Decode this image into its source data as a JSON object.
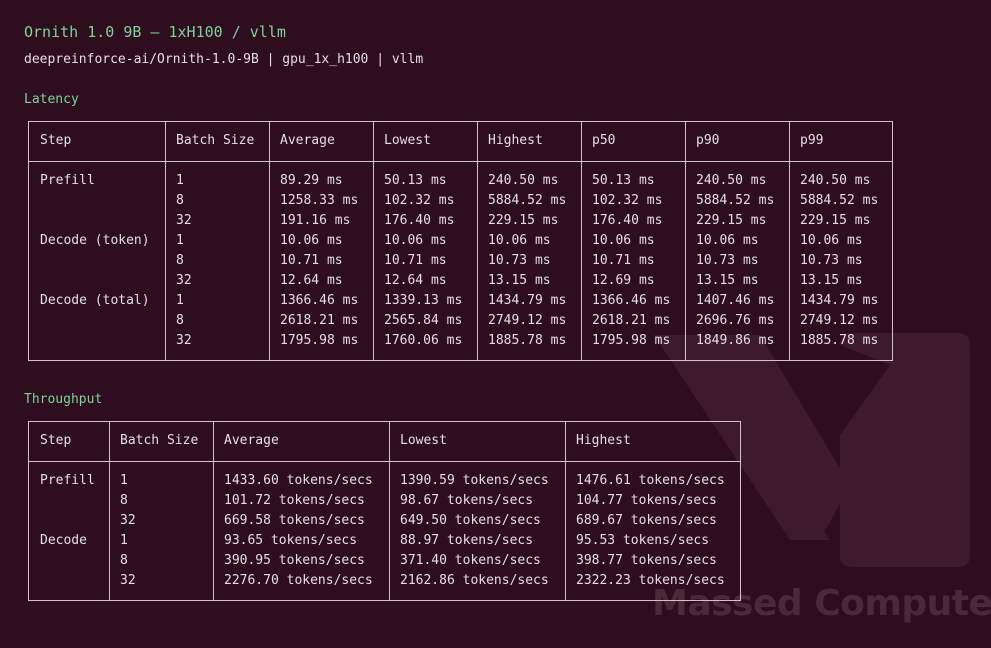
{
  "header": {
    "title": "Ornith 1.0 9B — 1xH100 / vllm",
    "subtitle": "deepreinforce-ai/Ornith-1.0-9B | gpu_1x_h100 | vllm"
  },
  "watermark": {
    "text": "Massed Compute",
    "logo_icon": "massed-compute-logo-icon"
  },
  "latency": {
    "label": "Latency",
    "columns": [
      "Step",
      "Batch Size",
      "Average",
      "Lowest",
      "Highest",
      "p50",
      "p90",
      "p99"
    ],
    "rows": [
      [
        "Prefill",
        "1",
        "89.29 ms",
        "50.13 ms",
        "240.50 ms",
        "50.13 ms",
        "240.50 ms",
        "240.50 ms"
      ],
      [
        "",
        "8",
        "1258.33 ms",
        "102.32 ms",
        "5884.52 ms",
        "102.32 ms",
        "5884.52 ms",
        "5884.52 ms"
      ],
      [
        "",
        "32",
        "191.16 ms",
        "176.40 ms",
        "229.15 ms",
        "176.40 ms",
        "229.15 ms",
        "229.15 ms"
      ],
      [
        "Decode (token)",
        "1",
        "10.06 ms",
        "10.06 ms",
        "10.06 ms",
        "10.06 ms",
        "10.06 ms",
        "10.06 ms"
      ],
      [
        "",
        "8",
        "10.71 ms",
        "10.71 ms",
        "10.73 ms",
        "10.71 ms",
        "10.73 ms",
        "10.73 ms"
      ],
      [
        "",
        "32",
        "12.64 ms",
        "12.64 ms",
        "13.15 ms",
        "12.69 ms",
        "13.15 ms",
        "13.15 ms"
      ],
      [
        "Decode (total)",
        "1",
        "1366.46 ms",
        "1339.13 ms",
        "1434.79 ms",
        "1366.46 ms",
        "1407.46 ms",
        "1434.79 ms"
      ],
      [
        "",
        "8",
        "2618.21 ms",
        "2565.84 ms",
        "2749.12 ms",
        "2618.21 ms",
        "2696.76 ms",
        "2749.12 ms"
      ],
      [
        "",
        "32",
        "1795.98 ms",
        "1760.06 ms",
        "1885.78 ms",
        "1795.98 ms",
        "1849.86 ms",
        "1885.78 ms"
      ]
    ]
  },
  "throughput": {
    "label": "Throughput",
    "columns": [
      "Step",
      "Batch Size",
      "Average",
      "Lowest",
      "Highest"
    ],
    "rows": [
      [
        "Prefill",
        "1",
        "1433.60 tokens/secs",
        "1390.59 tokens/secs",
        "1476.61 tokens/secs"
      ],
      [
        "",
        "8",
        "101.72 tokens/secs",
        "98.67 tokens/secs",
        "104.77 tokens/secs"
      ],
      [
        "",
        "32",
        "669.58 tokens/secs",
        "649.50 tokens/secs",
        "689.67 tokens/secs"
      ],
      [
        "Decode",
        "1",
        "93.65 tokens/secs",
        "88.97 tokens/secs",
        "95.53 tokens/secs"
      ],
      [
        "",
        "8",
        "390.95 tokens/secs",
        "371.40 tokens/secs",
        "398.77 tokens/secs"
      ],
      [
        "",
        "32",
        "2276.70 tokens/secs",
        "2162.86 tokens/secs",
        "2322.23 tokens/secs"
      ]
    ]
  }
}
